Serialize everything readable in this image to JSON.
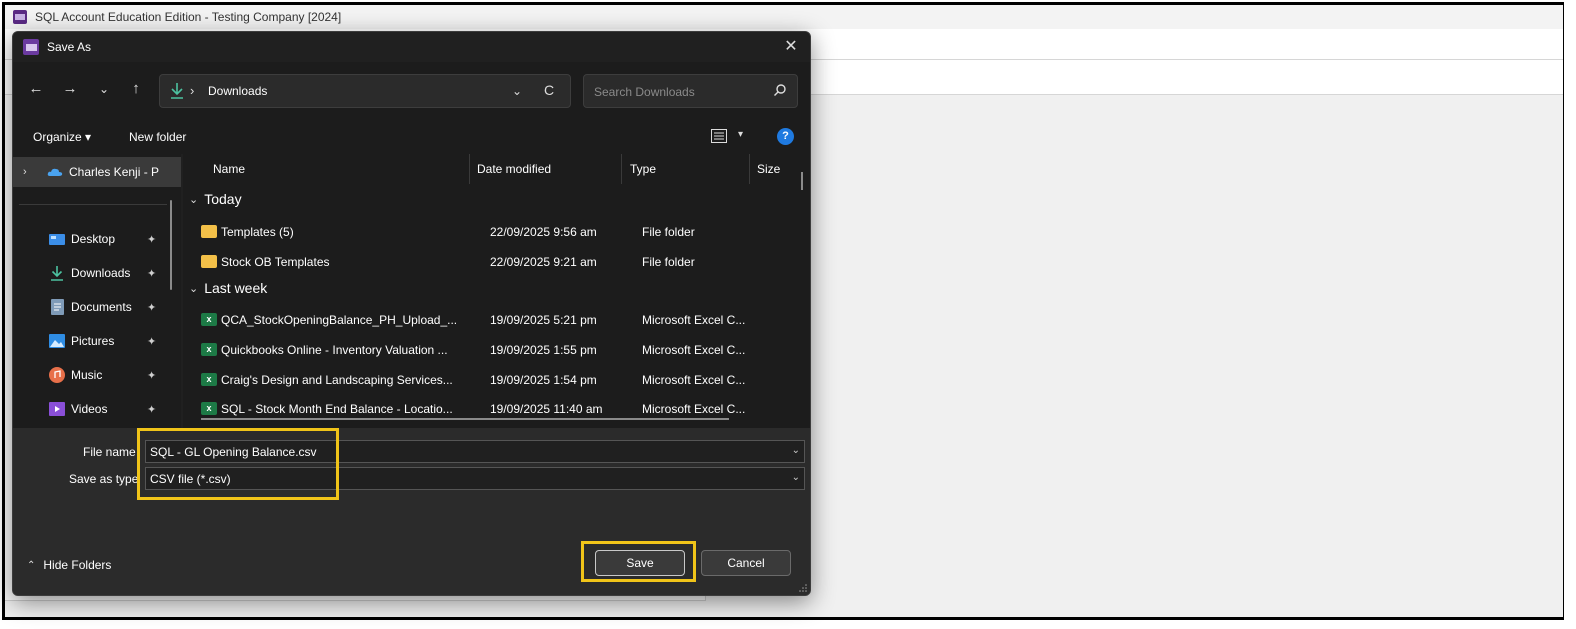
{
  "app": {
    "title": "SQL Account Education Edition - Testing Company [2024]"
  },
  "dialog": {
    "title": "Save As",
    "close_glyph": "✕"
  },
  "nav": {
    "back": "←",
    "forward": "→",
    "recent": "⌄",
    "up": "↑",
    "path_separator": "›",
    "path": "Downloads",
    "address_chevron": "⌄",
    "refresh": "C",
    "search_placeholder": "Search Downloads"
  },
  "commandbar": {
    "organize": "Organize ▾",
    "new_folder": "New folder",
    "help": "?"
  },
  "sidebar": {
    "items": [
      {
        "label": "Charles Kenji - P",
        "icon": "onedrive-icon"
      },
      {
        "label": "Desktop",
        "icon": "desktop-icon",
        "pin": "📌"
      },
      {
        "label": "Downloads",
        "icon": "download-icon",
        "pin": "📌"
      },
      {
        "label": "Documents",
        "icon": "document-icon",
        "pin": "📌"
      },
      {
        "label": "Pictures",
        "icon": "pictures-icon",
        "pin": "📌"
      },
      {
        "label": "Music",
        "icon": "music-icon",
        "pin": "📌"
      },
      {
        "label": "Videos",
        "icon": "videos-icon",
        "pin": "📌"
      }
    ]
  },
  "filelist": {
    "columns": [
      "Name",
      "Date modified",
      "Type",
      "Size"
    ],
    "groups": [
      {
        "label": "Today"
      },
      {
        "label": "Last week"
      }
    ],
    "rows": [
      {
        "name": "Templates (5)",
        "date": "22/09/2025 9:56 am",
        "type": "File folder",
        "icon": "folder-icon"
      },
      {
        "name": "Stock OB Templates",
        "date": "22/09/2025 9:21 am",
        "type": "File folder",
        "icon": "folder-icon"
      },
      {
        "name": "QCA_StockOpeningBalance_PH_Upload_...",
        "date": "19/09/2025 5:21 pm",
        "type": "Microsoft Excel C...",
        "icon": "excel-icon"
      },
      {
        "name": "Quickbooks Online - Inventory Valuation ...",
        "date": "19/09/2025 1:55 pm",
        "type": "Microsoft Excel C...",
        "icon": "excel-icon"
      },
      {
        "name": "Craig's Design and Landscaping Services...",
        "date": "19/09/2025 1:54 pm",
        "type": "Microsoft Excel C...",
        "icon": "excel-icon"
      },
      {
        "name": "SQL - Stock Month End Balance - Locatio...",
        "date": "19/09/2025 11:40 am",
        "type": "Microsoft Excel C...",
        "icon": "excel-icon"
      }
    ]
  },
  "form": {
    "file_name_label": "File name",
    "file_name_value": "SQL - GL Opening Balance.csv",
    "save_type_label": "Save as type",
    "save_type_value": "CSV file (*.csv)"
  },
  "footer": {
    "hide_folders": "Hide Folders",
    "save": "Save",
    "cancel": "Cancel"
  },
  "colors": {
    "highlight": "#f0c419",
    "dialog_bg": "#202020",
    "help_blue": "#1f7ae0",
    "download_green": "#4cc2a0"
  }
}
